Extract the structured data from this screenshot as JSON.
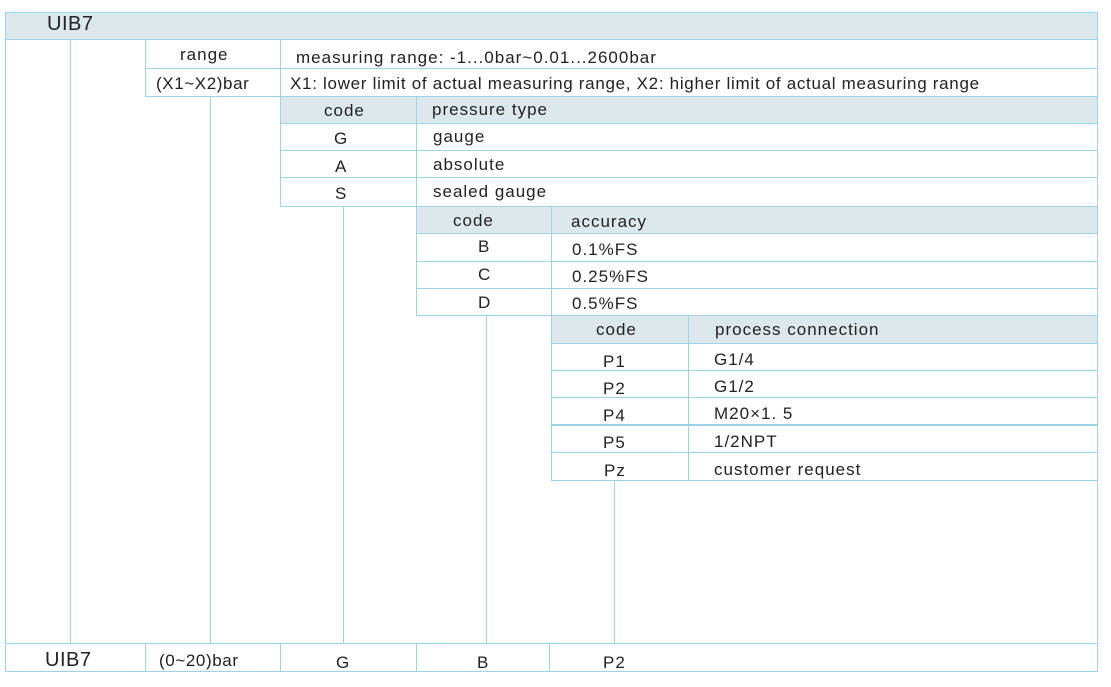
{
  "title": "UIB7",
  "range_section": {
    "label": "range",
    "desc": "measuring range: -1...0bar~0.01...2600bar",
    "unit_label": "(X1~X2)bar",
    "unit_desc": "X1: lower limit of actual measuring range, X2: higher limit of actual measuring range"
  },
  "pressure_type": {
    "code_header": "code",
    "name_header": "pressure type",
    "rows": [
      {
        "code": "G",
        "name": "gauge"
      },
      {
        "code": "A",
        "name": "absolute"
      },
      {
        "code": "S",
        "name": "sealed gauge"
      }
    ]
  },
  "accuracy": {
    "code_header": "code",
    "name_header": "accuracy",
    "rows": [
      {
        "code": "B",
        "name": "0.1%FS"
      },
      {
        "code": "C",
        "name": "0.25%FS"
      },
      {
        "code": "D",
        "name": "0.5%FS"
      }
    ]
  },
  "process_connection": {
    "code_header": "code",
    "name_header": "process connection",
    "rows": [
      {
        "code": "P1",
        "name": "G1/4"
      },
      {
        "code": "P2",
        "name": "G1/2"
      },
      {
        "code": "P4",
        "name": "M20×1. 5"
      },
      {
        "code": "P5",
        "name": "1/2NPT"
      },
      {
        "code": "Pz",
        "name": "customer request"
      }
    ]
  },
  "example": {
    "model": "UIB7",
    "range": "(0~20)bar",
    "pressure": "G",
    "accuracy": "B",
    "connection": "P2"
  },
  "colors": {
    "line": "#9ed3e6",
    "header_fill": "#dce8ec",
    "text": "#222222"
  }
}
